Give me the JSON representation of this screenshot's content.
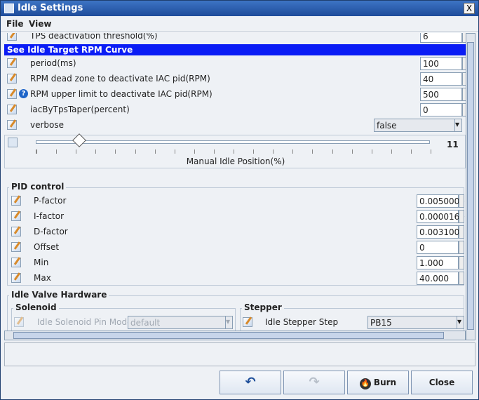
{
  "window": {
    "title": "Idle Settings",
    "close_glyph": "X"
  },
  "menu": {
    "items": [
      {
        "label": "File",
        "mnemonic": "F"
      },
      {
        "label": "View",
        "mnemonic": "V"
      }
    ]
  },
  "rows_top": {
    "tps_label": "TPS deactivation threshold(%)",
    "tps_value": "6"
  },
  "link": {
    "label": "See Idle Target RPM Curve"
  },
  "fields": [
    {
      "label": "period(ms)",
      "value": "100",
      "help": false
    },
    {
      "label": "RPM dead zone to deactivate IAC pid(RPM)",
      "value": "40",
      "help": false
    },
    {
      "label": "RPM upper limit to deactivate IAC pid(RPM)",
      "value": "500",
      "help": true
    },
    {
      "label": "iacByTpsTaper(percent)",
      "value": "0",
      "help": false
    }
  ],
  "verbose": {
    "label": "verbose",
    "value": "false"
  },
  "slider": {
    "caption": "Manual Idle Position(%)",
    "value": "11",
    "level_percent": 11
  },
  "pid": {
    "title": "PID control",
    "items": [
      {
        "label": "P-factor",
        "value": "0.0050000"
      },
      {
        "label": "I-factor",
        "value": "0.0000160"
      },
      {
        "label": "D-factor",
        "value": "0.0031001"
      },
      {
        "label": "Offset",
        "value": "0"
      },
      {
        "label": "Min",
        "value": "1.000"
      },
      {
        "label": "Max",
        "value": "40.000"
      }
    ]
  },
  "hardware": {
    "title": "Idle Valve Hardware",
    "solenoid": {
      "title": "Solenoid",
      "label": "Idle Solenoid Pin Mode",
      "value": "default"
    },
    "stepper": {
      "title": "Stepper",
      "label": "Idle Stepper Step",
      "value": "PB15"
    }
  },
  "buttons": {
    "burn": "Burn",
    "burn_mnemonic": "B",
    "close": "Close",
    "close_mnemonic": "C"
  },
  "colors": {
    "titlebar": "#2a5cae",
    "link_bar": "#0a1cf5",
    "help_badge": "#1d64c8"
  }
}
